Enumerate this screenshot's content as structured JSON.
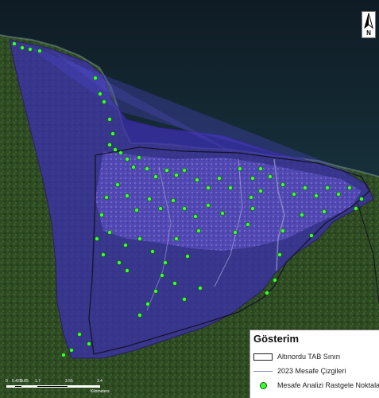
{
  "north_arrow": {
    "letter": "N",
    "icon": "north-arrow-icon"
  },
  "legend": {
    "title": "Gösterim",
    "items": [
      {
        "label": "Altınordu TAB Sınırı",
        "symbol": "boundary-box"
      },
      {
        "label": "2023 Mesafe Çizgileri",
        "symbol": "distance-line"
      },
      {
        "label": "Mesafe Analizi Rastgele Noktalar",
        "symbol": "green-point"
      }
    ]
  },
  "scale_bar": {
    "labels": [
      "0",
      "0.425",
      "0.85",
      "1.7",
      "2.55",
      "3.4"
    ],
    "unit": "Kilometers"
  },
  "colors": {
    "sea": "#12202a",
    "land": "#2f4a24",
    "analysis_area": "#3a2f9c",
    "points": "#3cff2e",
    "boundary": "#1a1a2e"
  }
}
